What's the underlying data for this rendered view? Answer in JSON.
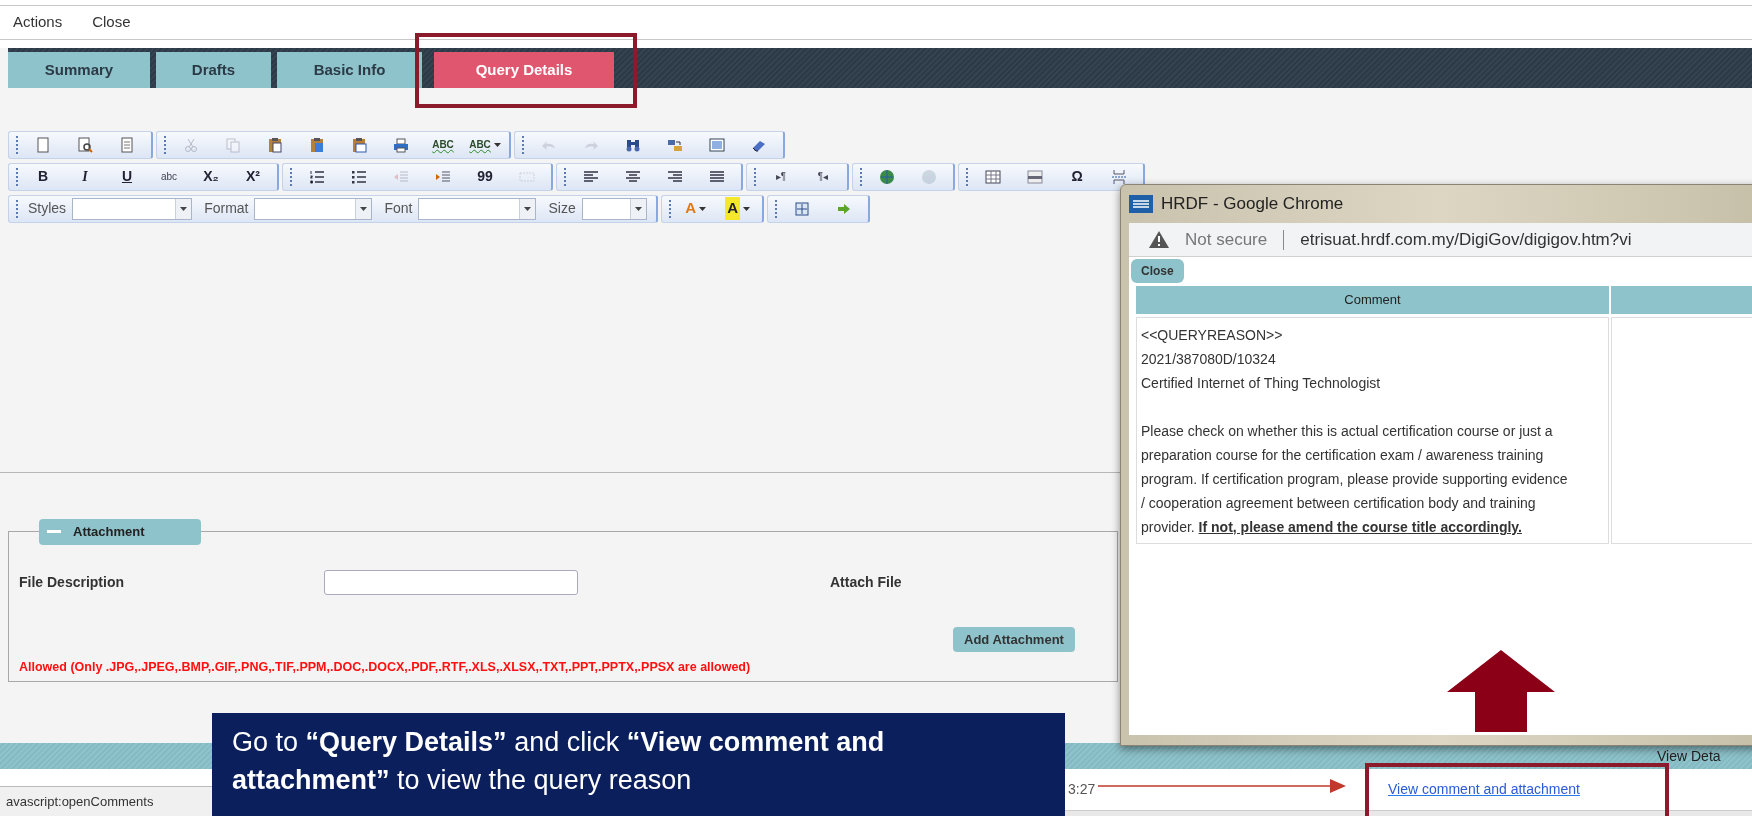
{
  "menu": [
    {
      "label": "Actions"
    },
    {
      "label": "Close"
    }
  ],
  "tabs": [
    {
      "label": "Summary",
      "selected": false
    },
    {
      "label": "Drafts",
      "selected": false
    },
    {
      "label": "Basic Info",
      "selected": false
    },
    {
      "label": "Query Details",
      "selected": true
    }
  ],
  "toolbar": {
    "rows": [
      {
        "groups": [
          [
            {
              "kind": "icon",
              "disabled": false
            },
            {
              "kind": "icon",
              "disabled": false
            },
            {
              "kind": "icon",
              "disabled": false
            }
          ],
          [
            {
              "kind": "icon",
              "disabled": true
            },
            {
              "kind": "icon",
              "disabled": true
            },
            {
              "kind": "icon",
              "disabled": false
            },
            {
              "kind": "icon",
              "disabled": false
            },
            {
              "kind": "icon",
              "disabled": false
            },
            {
              "kind": "icon",
              "disabled": false
            },
            {
              "kind": "spell",
              "glyph": "ABC",
              "disabled": false
            },
            {
              "kind": "spell",
              "glyph": "ABC",
              "dropdown": true,
              "disabled": false
            }
          ],
          [
            {
              "kind": "icon",
              "disabled": true
            },
            {
              "kind": "icon",
              "disabled": true
            },
            {
              "kind": "icon",
              "disabled": false
            },
            {
              "kind": "icon",
              "disabled": false
            },
            {
              "kind": "icon",
              "disabled": false
            },
            {
              "kind": "icon",
              "disabled": false
            }
          ]
        ]
      },
      {
        "groups": [
          [
            {
              "kind": "bold",
              "glyph": "B",
              "disabled": false
            },
            {
              "kind": "italic",
              "glyph": "I",
              "disabled": false
            },
            {
              "kind": "underline",
              "glyph": "U",
              "disabled": false
            },
            {
              "kind": "small",
              "glyph": "abc",
              "disabled": false
            },
            {
              "kind": "bold",
              "glyph": "X₂",
              "disabled": false
            },
            {
              "kind": "bold",
              "glyph": "X²",
              "disabled": false
            }
          ],
          [
            {
              "kind": "icon",
              "disabled": false
            },
            {
              "kind": "icon",
              "disabled": false
            },
            {
              "kind": "icon",
              "disabled": true
            },
            {
              "kind": "icon",
              "disabled": false
            },
            {
              "kind": "bold",
              "glyph": "99",
              "disabled": false
            },
            {
              "kind": "icon",
              "disabled": true
            }
          ],
          [
            {
              "kind": "icon",
              "disabled": false
            },
            {
              "kind": "icon",
              "disabled": false
            },
            {
              "kind": "icon",
              "disabled": false
            },
            {
              "kind": "icon",
              "disabled": false
            }
          ],
          [
            {
              "kind": "small",
              "glyph": "▸¶",
              "disabled": false
            },
            {
              "kind": "small",
              "glyph": "¶◂",
              "disabled": false
            }
          ],
          [
            {
              "kind": "icon",
              "disabled": false
            },
            {
              "kind": "icon",
              "disabled": true
            }
          ],
          [
            {
              "kind": "icon",
              "disabled": false
            },
            {
              "kind": "icon",
              "disabled": false
            },
            {
              "kind": "bold",
              "glyph": "Ω",
              "disabled": false
            },
            {
              "kind": "icon",
              "disabled": false
            }
          ]
        ]
      },
      {
        "combos": [
          {
            "label": "Styles"
          },
          {
            "label": "Format"
          },
          {
            "label": "Font"
          },
          {
            "label": "Size"
          }
        ],
        "groups": [
          [
            {
              "kind": "text-color",
              "glyph": "A",
              "dropdown": true,
              "disabled": false
            },
            {
              "kind": "bg-color",
              "glyph": "A",
              "dropdown": true,
              "disabled": false
            }
          ],
          [
            {
              "kind": "icon",
              "disabled": false
            },
            {
              "kind": "icon",
              "disabled": false
            }
          ]
        ]
      }
    ]
  },
  "attachment": {
    "legend": "Attachment",
    "file_description_label": "File Description",
    "attach_file_label": "Attach File",
    "add_button": "Add Attachment",
    "allowed_note": "Allowed (Only .JPG,.JPEG,.BMP,.GIF,.PNG,.TIF,.PPM,.DOC,.DOCX,.PDF,.RTF,.XLS,.XLSX,.TXT,.PPT,.PPTX,.PPSX are allowed)"
  },
  "table": {
    "header_cell": "View Deta",
    "row": {
      "time": "3:27",
      "link": "View comment and attachment"
    }
  },
  "status_text": "avascript:openComments",
  "popup": {
    "title": "HRDF - Google Chrome",
    "security": "Not secure",
    "url": "etrisuat.hrdf.com.my/DigiGov/digigov.htm?vi",
    "close_button": "Close",
    "columns": [
      "Comment"
    ],
    "comment_lines": [
      "<<QUERYREASON>>",
      "2021/387080D/10324",
      "Certified Internet of Thing Technologist"
    ],
    "comment_paragraph": "Please check on whether this is actual certification course or just a preparation course for the certification exam / awareness training program. If certification program, please provide supporting evidence / cooperation agreement between certification body and training provider. **If not, please amend the course title accordingly.**"
  },
  "callout": {
    "text": "Go to **“Query Details”** and click **“View comment and attachment”** to view the query reason"
  }
}
